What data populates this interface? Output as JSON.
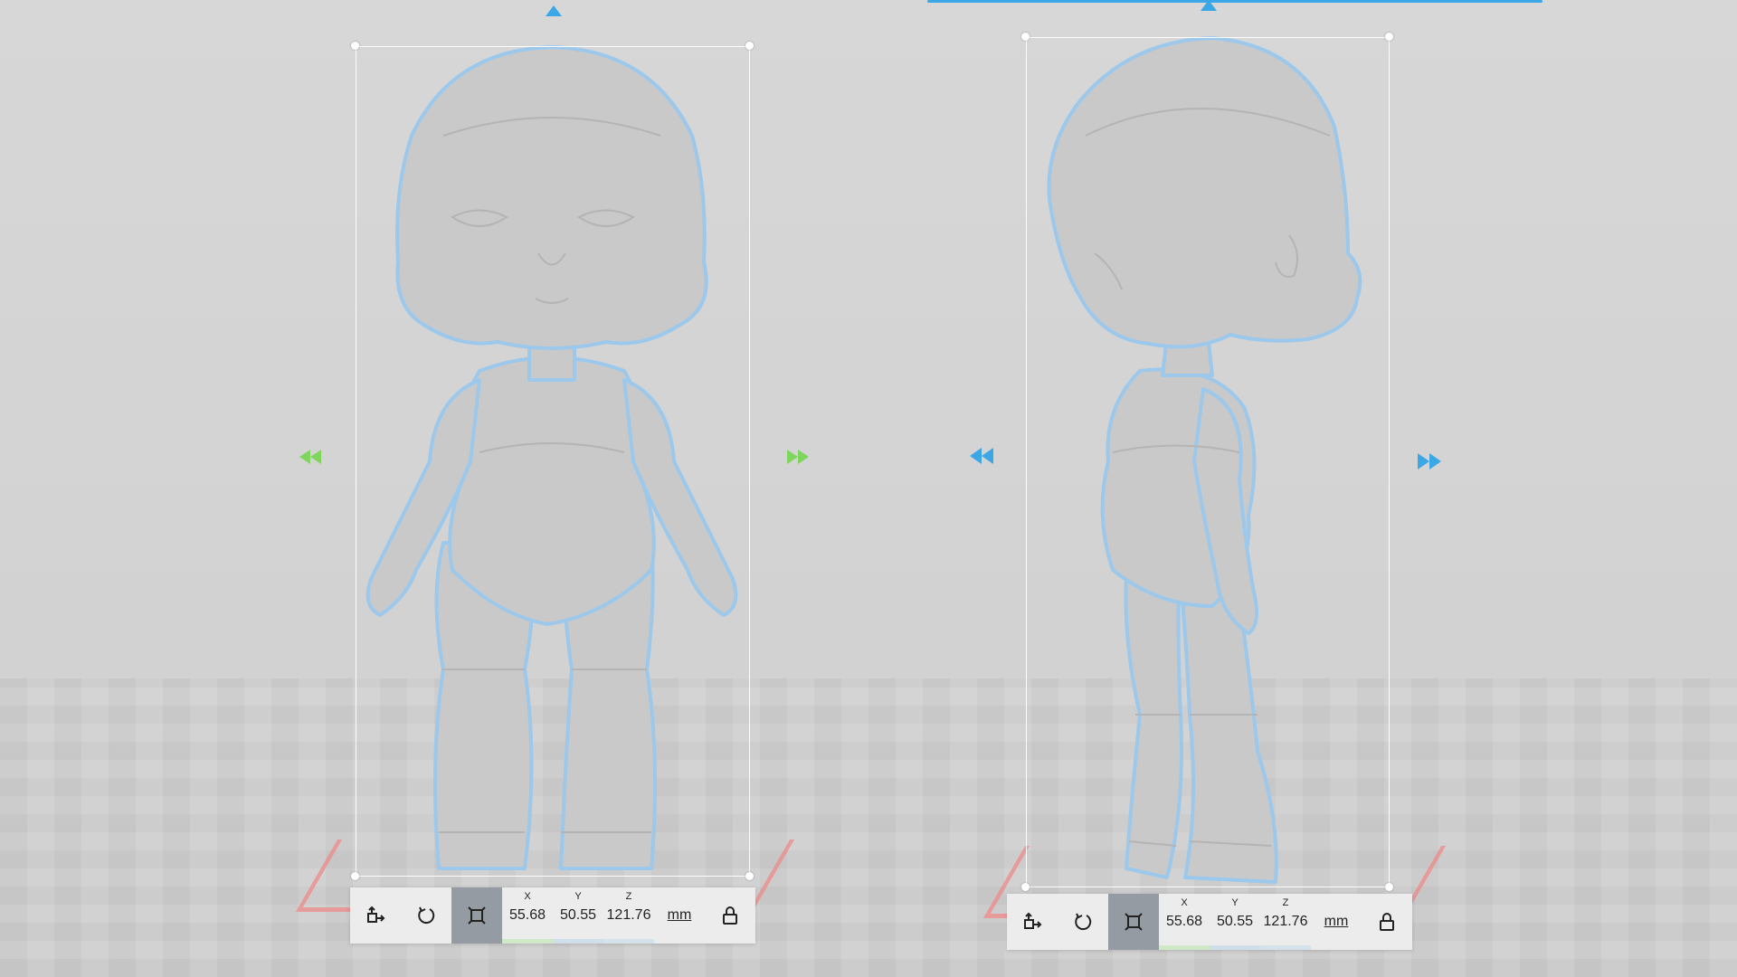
{
  "views": [
    {
      "id": "front",
      "toolbar": {
        "move_icon": "move-icon",
        "rotate_icon": "rotate-icon",
        "scale_icon": "scale-icon",
        "x_label": "X",
        "x_value": "55.68",
        "y_label": "Y",
        "y_value": "50.55",
        "z_label": "Z",
        "z_value": "121.76",
        "unit": "mm",
        "lock_icon": "lock-icon"
      }
    },
    {
      "id": "side",
      "toolbar": {
        "move_icon": "move-icon",
        "rotate_icon": "rotate-icon",
        "scale_icon": "scale-icon",
        "x_label": "X",
        "x_value": "55.68",
        "y_label": "Y",
        "y_value": "50.55",
        "z_label": "Z",
        "z_value": "121.76",
        "unit": "mm",
        "lock_icon": "lock-icon"
      }
    }
  ],
  "colors": {
    "accent": "#3ba7e6",
    "model": "#c7c7c7",
    "model_outline": "#9cc8ec",
    "x_axis": "#7fd65c",
    "bed_outline": "#ef8a8a"
  }
}
